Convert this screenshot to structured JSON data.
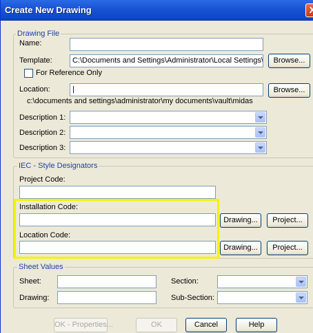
{
  "window": {
    "title": "Create New Drawing",
    "close_glyph": "X"
  },
  "drawing_file": {
    "legend": "Drawing File",
    "name_label": "Name:",
    "name_value": "",
    "template_label": "Template:",
    "template_value": "C:\\Documents and Settings\\Administrator\\Local Settings\\Application D",
    "browse_label": "Browse...",
    "for_reference_label": "For Reference Only",
    "location_label": "Location:",
    "location_value": "|",
    "location_browse_label": "Browse...",
    "location_path": "c:\\documents and settings\\administrator\\my documents\\vault\\midas",
    "description1_label": "Description 1:",
    "description2_label": "Description 2:",
    "description3_label": "Description 3:"
  },
  "iec": {
    "legend": "IEC - Style Designators",
    "project_code_label": "Project Code:",
    "installation_code_label": "Installation Code:",
    "location_code_label": "Location Code:",
    "drawing_button": "Drawing...",
    "project_button": "Project..."
  },
  "sheet_values": {
    "legend": "Sheet Values",
    "sheet_label": "Sheet:",
    "section_label": "Section:",
    "drawing_label": "Drawing:",
    "subsection_label": "Sub-Section:"
  },
  "footer": {
    "ok_properties": "OK - Properties...",
    "ok": "OK",
    "cancel": "Cancel",
    "help": "Help"
  },
  "colors": {
    "highlight": "#f7f200",
    "titlebar": "#0b45c8",
    "legend_text": "#1f3fa8"
  }
}
